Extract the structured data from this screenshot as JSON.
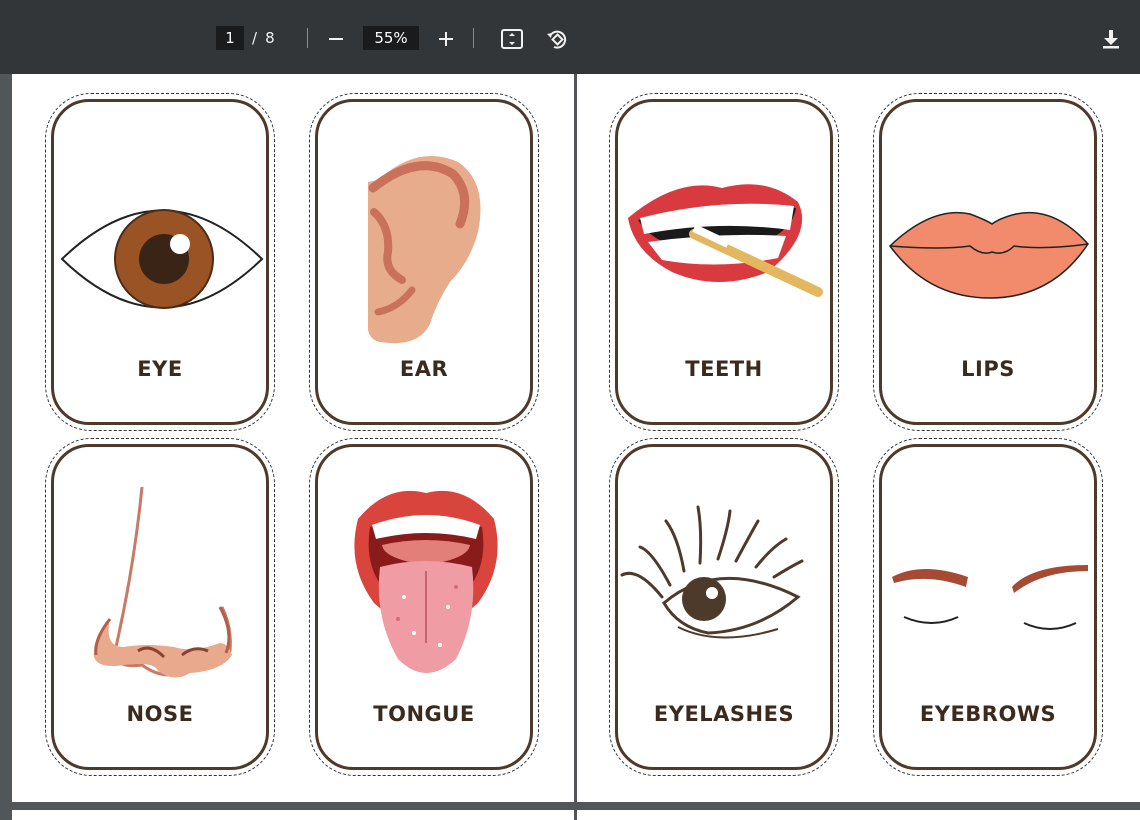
{
  "toolbar": {
    "current_page": "1",
    "page_separator": "/",
    "total_pages": "8",
    "zoom": "55%",
    "zoom_out_icon": "minus-icon",
    "zoom_in_icon": "plus-icon",
    "fit_icon": "fit-page-icon",
    "rotate_icon": "rotate-icon",
    "download_icon": "download-icon"
  },
  "cards": [
    {
      "label": "EYE"
    },
    {
      "label": "EAR"
    },
    {
      "label": "NOSE"
    },
    {
      "label": "TONGUE"
    },
    {
      "label": "TEETH"
    },
    {
      "label": "LIPS"
    },
    {
      "label": "EYELASHES"
    },
    {
      "label": "EYEBROWS"
    }
  ],
  "colors": {
    "toolbar_bg": "#323639",
    "viewer_bg": "#525659",
    "card_border": "#4d3a2a",
    "label_text": "#3b2a1e"
  }
}
